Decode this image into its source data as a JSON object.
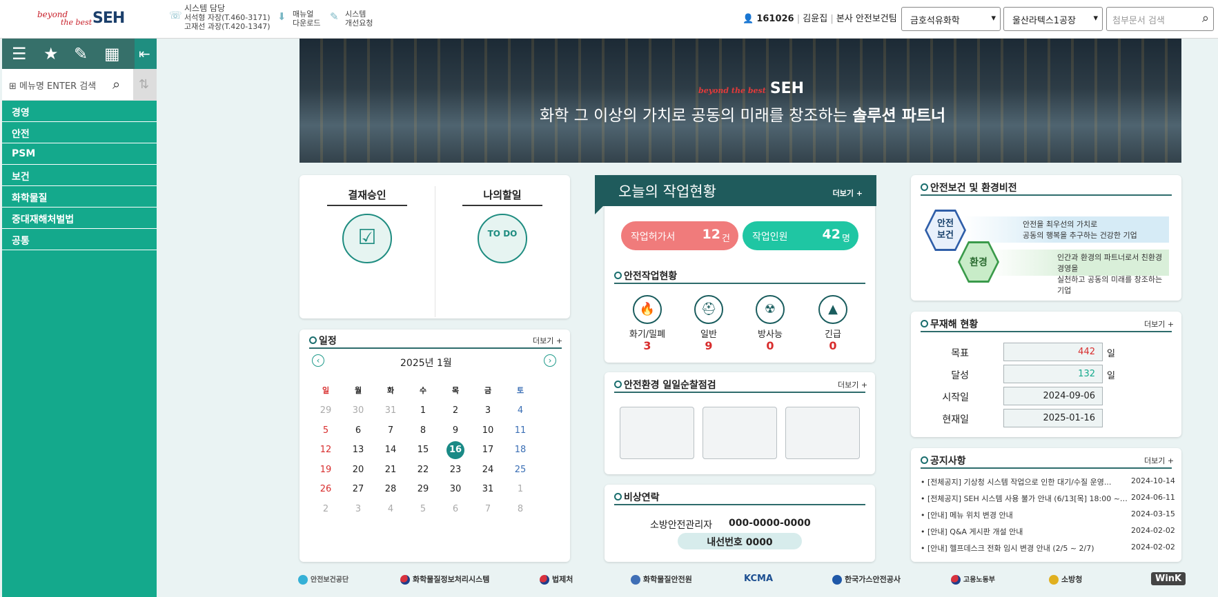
{
  "header": {
    "logo_line1": "beyond",
    "logo_line2": "the best",
    "logo_brand": "SEH",
    "contact_title": "시스템 담당",
    "contact1": "서석형 자장(T.460-3171)",
    "contact2": "고재선 과장(T.420-1347)",
    "manual_line1": "매뉴얼",
    "manual_line2": "다운로드",
    "improve_line1": "시스템",
    "improve_line2": "개선요청",
    "user_id": "161026",
    "user_name": "김윤집",
    "user_dept": "본사 안전보건팀",
    "company_select": "금호석유화학",
    "plant_select": "울산라텍스1공장",
    "search_placeholder": "첨부문서 검색"
  },
  "sidebar": {
    "menu_search_placeholder": "메뉴명 ENTER 검색",
    "menu": [
      "경영",
      "안전",
      "PSM",
      "보건",
      "화학물질",
      "중대재해처벌법",
      "공통"
    ]
  },
  "banner": {
    "logo": "SEH",
    "logo_tag": "beyond the best",
    "slogan_main": "화학 그 이상의 가치로 공동의 미래를 창조하는 ",
    "slogan_bold": "솔루션 파트너"
  },
  "quick": {
    "approval": "결재승인",
    "todo": "나의할일",
    "todo_icon_text": "TO DO"
  },
  "calendar": {
    "title": "일정",
    "more": "더보기 +",
    "month": "2025년 1월",
    "weekdays": [
      "일",
      "월",
      "화",
      "수",
      "목",
      "금",
      "토"
    ],
    "weeks": [
      [
        "29",
        "30",
        "31",
        "1",
        "2",
        "3",
        "4"
      ],
      [
        "5",
        "6",
        "7",
        "8",
        "9",
        "10",
        "11"
      ],
      [
        "12",
        "13",
        "14",
        "15",
        "16",
        "17",
        "18"
      ],
      [
        "19",
        "20",
        "21",
        "22",
        "23",
        "24",
        "25"
      ],
      [
        "26",
        "27",
        "28",
        "29",
        "30",
        "31",
        "1"
      ],
      [
        "2",
        "3",
        "4",
        "5",
        "6",
        "7",
        "8"
      ]
    ],
    "today": "16"
  },
  "work": {
    "title": "오늘의 작업현황",
    "more": "더보기 +",
    "permit_label": "작업허가서",
    "permit_count": "12",
    "permit_unit": "건",
    "workers_label": "작업인원",
    "workers_count": "42",
    "workers_unit": "명",
    "safety_title": "안전작업현황",
    "items": [
      {
        "label": "화기/밀폐",
        "count": "3"
      },
      {
        "label": "일반",
        "count": "9"
      },
      {
        "label": "방사능",
        "count": "0"
      },
      {
        "label": "긴급",
        "count": "0"
      }
    ]
  },
  "daily_check": {
    "title": "안전환경 일일순찰점검",
    "more": "더보기 +"
  },
  "emergency": {
    "title": "비상연락",
    "role": "소방안전관리자",
    "phone": "000-0000-0000",
    "ext": "내선번호 0000"
  },
  "vision": {
    "title": "안전보건 및 환경비전",
    "safety_hex": "안전\n보건",
    "safety_line1": "안전을 최우선의 가치로",
    "safety_line2": "공동의 행복을 추구하는 건강한 기업",
    "env_hex": "환경",
    "env_line1": "인간과 환경의 파트너로서 친환경 경영을",
    "env_line2": "실천하고 공동의 미래를 창조하는 기업"
  },
  "nodisaster": {
    "title": "무재해 현황",
    "more": "더보기 +",
    "goal_label": "목표",
    "goal_value": "442",
    "goal_unit": "일",
    "achieved_label": "달성",
    "achieved_value": "132",
    "achieved_unit": "일",
    "start_label": "시작일",
    "start_value": "2024-09-06",
    "current_label": "현재일",
    "current_value": "2025-01-16"
  },
  "notices": {
    "title": "공지사항",
    "more": "더보기 +",
    "items": [
      {
        "text": "• [전체공지] 기상청 시스템 작업으로 인한 대기/수질 운영...",
        "date": "2024-10-14"
      },
      {
        "text": "• [전체공지] SEH 시스템 사용 불가 안내 (6/13[목] 18:00 ~ ...",
        "date": "2024-06-11"
      },
      {
        "text": "• [안내] 메뉴 위치 변경 안내",
        "date": "2024-03-15"
      },
      {
        "text": "• [안내] Q&A 게시판 개설 안내",
        "date": "2024-02-02"
      },
      {
        "text": "• [안내] 헬프데스크 전화 임시 변경 안내 (2/5 ~ 2/7)",
        "date": "2024-02-02"
      }
    ]
  },
  "partners": [
    "안전보건공단",
    "화학물질정보처리시스템",
    "법제처",
    "화학물질안전원",
    "KCMA",
    "한국가스안전공사",
    "고용노동부",
    "소방청",
    "WinK"
  ],
  "colors": {
    "primary": "#14a98c",
    "dark": "#1f5b5c",
    "permit_pill": "#f07b7b",
    "workers_pill": "#1fc6a3",
    "alert_red": "#d82d2d"
  }
}
